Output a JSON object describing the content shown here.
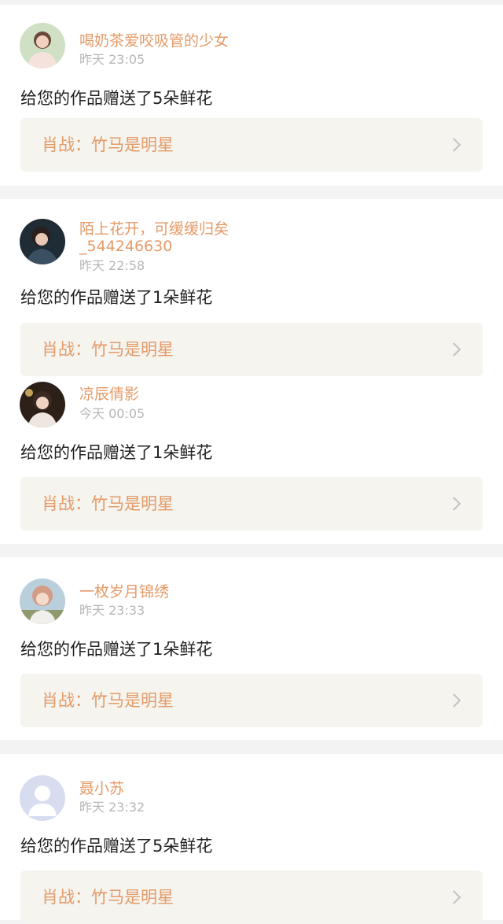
{
  "entries": [
    {
      "username": "喝奶茶爱咬吸管的少女",
      "time": "昨天 23:05",
      "message": "给您的作品赠送了5朵鲜花",
      "work_title": "肖战：竹马是明星"
    },
    {
      "username": "陌上花开，可缓缓归矣",
      "username_line2": "_544246630",
      "time": "昨天 22:58",
      "message": "给您的作品赠送了1朵鲜花",
      "work_title": "肖战：竹马是明星"
    },
    {
      "username": "凉辰倩影",
      "time": "今天 00:05",
      "message": "给您的作品赠送了1朵鲜花",
      "work_title": "肖战：竹马是明星"
    },
    {
      "username": "一枚岁月锦绣",
      "time": "昨天 23:33",
      "message": "给您的作品赠送了1朵鲜花",
      "work_title": "肖战：竹马是明星"
    },
    {
      "username": "聂小苏",
      "time": "昨天 23:32",
      "message": "给您的作品赠送了5朵鲜花",
      "work_title": "肖战：竹马是明星"
    }
  ],
  "icons": {
    "chevron": "chevron-right-icon",
    "default_avatar": "default-avatar-icon"
  },
  "colors": {
    "accent": "#e49a67",
    "time": "#b6b6b6",
    "text": "#222222",
    "work_bg": "#f5f4ef",
    "separator": "#f3f3f3"
  }
}
